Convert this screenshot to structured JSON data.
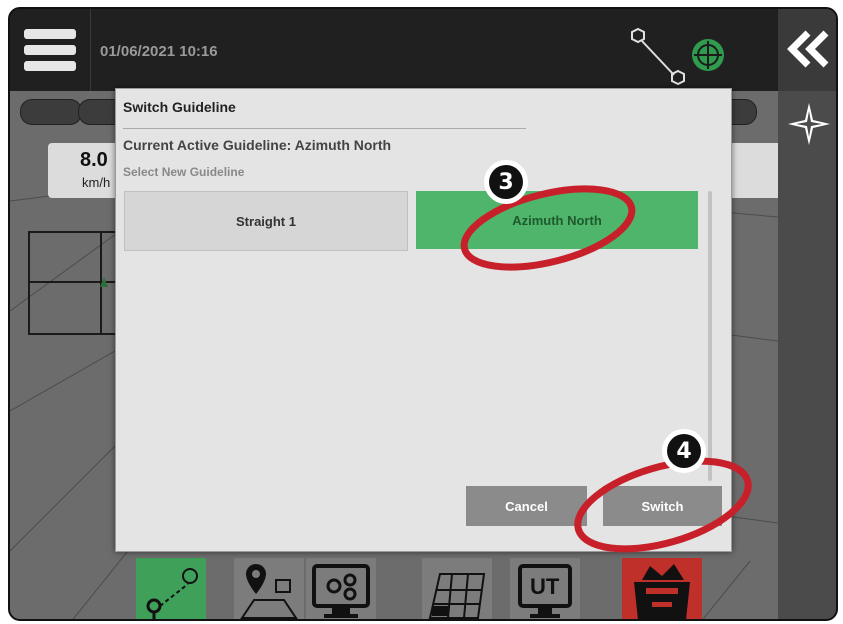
{
  "status_bar": {
    "datetime": "01/06/2021 10:16"
  },
  "speed_panel": {
    "value": "8.0",
    "unit": "km/h"
  },
  "dialog": {
    "title": "Switch Guideline",
    "current_label": "Current Active Guideline: Azimuth North",
    "select_label": "Select New Guideline",
    "guidelines": [
      {
        "label": "Straight 1",
        "selected": false
      },
      {
        "label": "Azimuth North",
        "selected": true
      }
    ],
    "cancel_label": "Cancel",
    "switch_label": "Switch"
  },
  "callouts": [
    {
      "number": "3"
    },
    {
      "number": "4"
    }
  ],
  "dock": {
    "ut_label": "UT"
  },
  "icons": [
    "menu-icon",
    "gps-antenna-icon",
    "satellite-globe-icon",
    "collapse-double-chevron-icon",
    "compass-icon",
    "guideline-icon",
    "field-location-icon",
    "machine-settings-icon",
    "coverage-map-icon",
    "ut-icon",
    "toolbox-icon"
  ],
  "colors": {
    "accent_green": "#4eb56a",
    "callout_red": "#c8202a",
    "button_gray": "#8b8b8b",
    "toolbox_red": "#c0302a"
  }
}
